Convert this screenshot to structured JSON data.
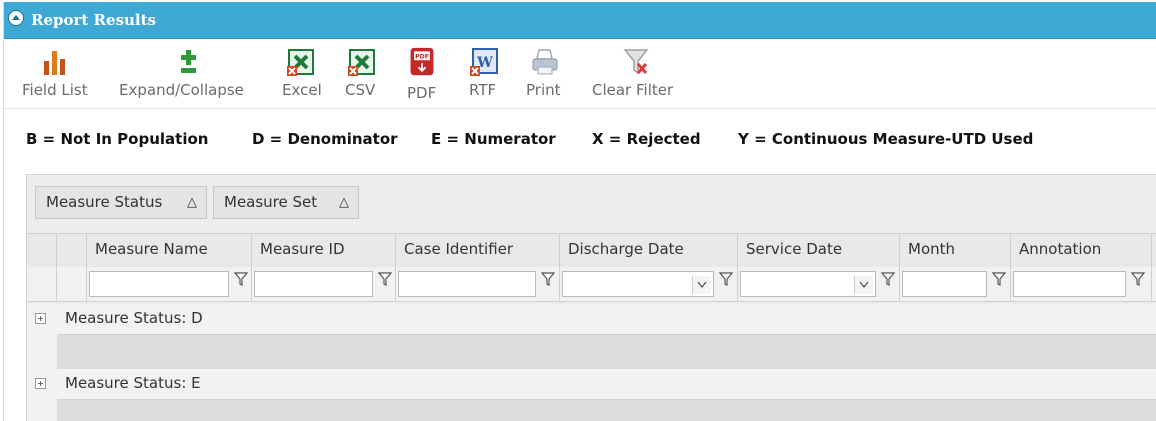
{
  "panel": {
    "title": "Report Results",
    "collapse_icon": "chevron-up-circle-icon"
  },
  "toolbar": {
    "items": [
      {
        "label": "Field List",
        "icon": "field-list-icon"
      },
      {
        "label": "Expand/Collapse",
        "icon": "expand-collapse-icon"
      },
      {
        "label": "Excel",
        "icon": "excel-icon"
      },
      {
        "label": "CSV",
        "icon": "csv-icon"
      },
      {
        "label": "PDF",
        "icon": "pdf-icon"
      },
      {
        "label": "RTF",
        "icon": "rtf-icon"
      },
      {
        "label": "Print",
        "icon": "print-icon"
      },
      {
        "label": "Clear Filter",
        "icon": "clear-filter-icon"
      }
    ]
  },
  "legend": {
    "b": "B = Not In Population",
    "d": "D = Denominator",
    "e": "E = Numerator",
    "x": "X = Rejected",
    "y": "Y = Continuous Measure-UTD Used"
  },
  "grid": {
    "group_by": [
      {
        "label": "Measure Status",
        "sort": "△"
      },
      {
        "label": "Measure Set",
        "sort": "△"
      }
    ],
    "columns": [
      "Measure Name",
      "Measure ID",
      "Case Identifier",
      "Discharge Date",
      "Service Date",
      "Month",
      "Annotation"
    ],
    "filters": {
      "measure_name": "",
      "measure_id": "",
      "case_identifier": "",
      "discharge_date": "",
      "service_date": "",
      "month": "",
      "annotation": ""
    },
    "groups": [
      {
        "label": "Measure Status: D"
      },
      {
        "label": "Measure Status: E"
      }
    ]
  },
  "colors": {
    "title_bar": "#3fa9d6",
    "excel_green": "#1f7a3a",
    "pdf_red": "#c62828",
    "rtf_blue": "#2f5fae"
  }
}
